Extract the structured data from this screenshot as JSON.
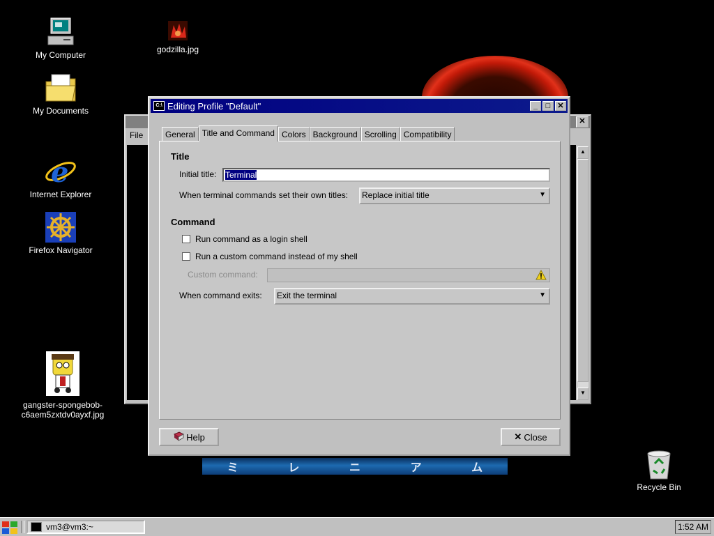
{
  "desktop": {
    "icons": [
      {
        "label": "My Computer"
      },
      {
        "label": "godzilla.jpg"
      },
      {
        "label": "My Documents"
      },
      {
        "label": "Internet Explorer"
      },
      {
        "label": "Firefox Navigator"
      },
      {
        "label": "gangster-spongebob-c6aem5zxtdv0ayxf.jpg"
      },
      {
        "label": "Recycle Bin"
      }
    ],
    "banner_chars": [
      "ミ",
      "レ",
      "ニ",
      "ア",
      "ム"
    ]
  },
  "background_window": {
    "menu_file": "File",
    "close_glyph": "✕"
  },
  "dialog": {
    "title": "Editing Profile \"Default\"",
    "tabs": [
      "General",
      "Title and Command",
      "Colors",
      "Background",
      "Scrolling",
      "Compatibility"
    ],
    "active_tab": "Title and Command",
    "title_section": {
      "heading": "Title",
      "initial_title_label": "Initial title:",
      "initial_title_value": "Terminal",
      "dynamic_title_label": "When terminal commands set their own titles:",
      "dynamic_title_value": "Replace initial title"
    },
    "command_section": {
      "heading": "Command",
      "login_shell_label": "Run command as a login shell",
      "custom_command_check_label": "Run a custom command instead of my shell",
      "custom_command_label": "Custom command:",
      "exit_label": "When command exits:",
      "exit_value": "Exit the terminal"
    },
    "buttons": {
      "help": "Help",
      "close": "Close"
    }
  },
  "taskbar": {
    "task_label": "vm3@vm3:~",
    "clock": "1:52 AM"
  },
  "colors": {
    "titlebar": "#000080",
    "face": "#c0c0c0",
    "desktop": "#000000"
  }
}
